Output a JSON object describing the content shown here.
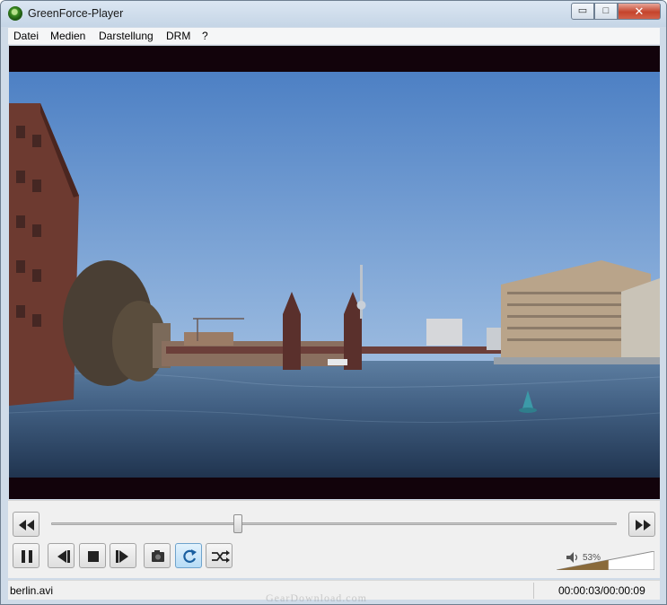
{
  "window": {
    "title": "GreenForce-Player",
    "minimize_label": "▭",
    "maximize_label": "□",
    "close_label": "✕"
  },
  "menu": [
    "Datei",
    "Medien",
    "Darstellung",
    "DRM",
    "?"
  ],
  "controls": {
    "buttons": [
      {
        "name": "rewind-button",
        "icon": "rewind-icon"
      },
      {
        "name": "fast-forward-button",
        "icon": "fast-forward-icon"
      },
      {
        "name": "pause-button",
        "icon": "pause-icon"
      },
      {
        "name": "previous-button",
        "icon": "skip-back-icon"
      },
      {
        "name": "stop-button",
        "icon": "stop-icon"
      },
      {
        "name": "next-button",
        "icon": "skip-forward-icon"
      },
      {
        "name": "snapshot-button",
        "icon": "camera-icon"
      },
      {
        "name": "repeat-button",
        "icon": "repeat-icon",
        "active": true
      },
      {
        "name": "shuffle-button",
        "icon": "shuffle-icon"
      }
    ],
    "seek_position": 0.33,
    "volume_label": "53%",
    "volume_level": 0.53
  },
  "status": {
    "file": "berlin.avi",
    "time": "00:00:03/00:00:09"
  },
  "watermark": "GearDownload.com",
  "colors": {
    "accent_active": "#b7dcf6",
    "volume_fill": "#8a6a3a"
  }
}
